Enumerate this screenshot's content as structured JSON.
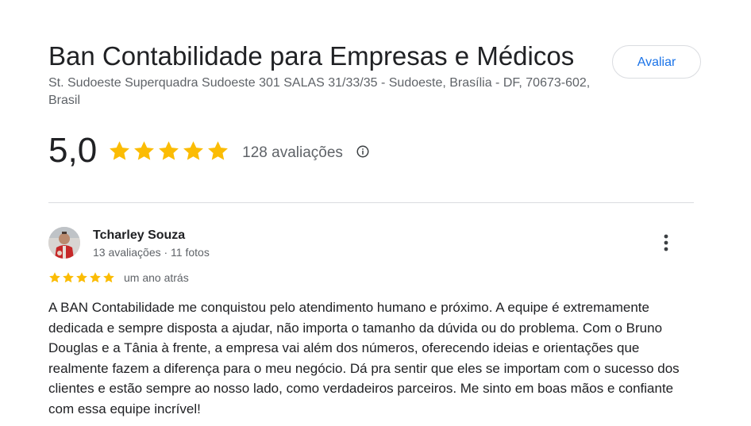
{
  "business": {
    "name": "Ban Contabilidade para Empresas e Médicos",
    "address": "St. Sudoeste Superquadra Sudoeste 301 SALAS 31/33/35 - Sudoeste, Brasília - DF, 70673-602, Brasil",
    "rate_button_label": "Avaliar"
  },
  "rating": {
    "value_text": "5,0",
    "stars_filled": 5,
    "stars_total": 5,
    "review_count_text": "128 avaliações",
    "info_icon": "info-icon"
  },
  "review": {
    "reviewer_name": "Tcharley Souza",
    "reviewer_meta": "13 avaliações · 11 fotos",
    "stars_filled": 5,
    "date": "um ano atrás",
    "text": "A BAN Contabilidade me conquistou pelo atendimento humano e próximo. A equipe é extremamente dedicada e sempre disposta a ajudar, não importa o tamanho da dúvida ou do problema. Com o Bruno Douglas e a Tânia à frente, a empresa vai além dos números, oferecendo ideias e orientações que realmente fazem a diferença para o meu negócio. Dá pra sentir que eles se importam com o sucesso dos clientes e estão sempre ao nosso lado, como verdadeiros parceiros. Me sinto em boas mãos e confiante com essa equipe incrível!",
    "more_icon": "more-vert-icon",
    "avatar": "avatar"
  },
  "colors": {
    "star": "#fbbc04",
    "accent": "#1a73e8",
    "secondary_text": "#5f6368",
    "primary_text": "#202124",
    "divider": "#dadce0"
  }
}
